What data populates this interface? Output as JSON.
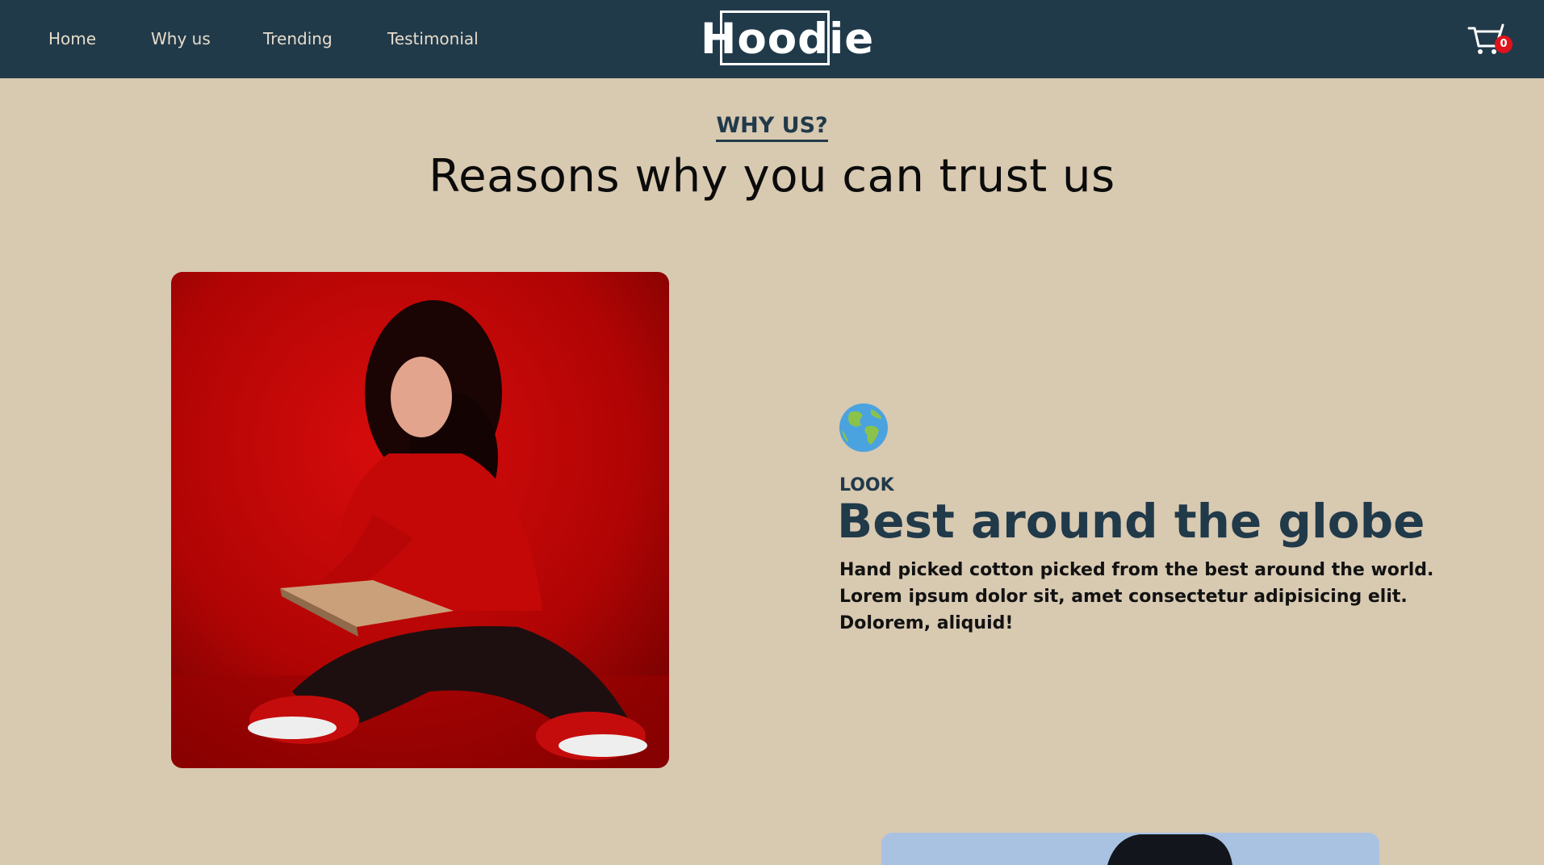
{
  "nav": {
    "links": [
      "Home",
      "Why us",
      "Trending",
      "Testimonial"
    ],
    "brand": "Hoodie",
    "cart_count": "0"
  },
  "section": {
    "eyebrow": "WHY US?",
    "title": "Reasons why you can trust us"
  },
  "feature": {
    "icon": "globe-icon",
    "eyebrow": "LOOK",
    "title": "Best around the globe",
    "description": "Hand picked cotton picked from the best around the world. Lorem ipsum dolor sit, amet consectetur adipisicing elit. Dolorem, aliquid!"
  },
  "colors": {
    "navbar": "#213a4a",
    "background": "#d8c9b1",
    "accent": "#213a4a",
    "badge": "#e0121c"
  }
}
